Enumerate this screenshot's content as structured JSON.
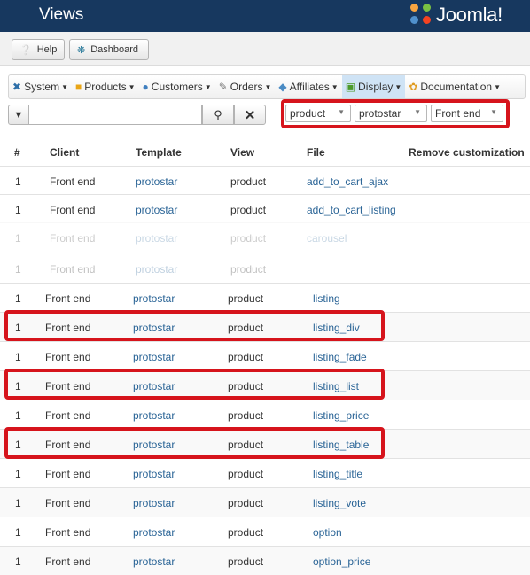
{
  "header": {
    "title": "Views",
    "logo_text": "Joomla!"
  },
  "toolbar": {
    "help_label": "Help",
    "dashboard_label": "Dashboard"
  },
  "menu": {
    "items": [
      {
        "label": "System",
        "icon": "wrench-icon"
      },
      {
        "label": "Products",
        "icon": "box-icon"
      },
      {
        "label": "Customers",
        "icon": "people-icon"
      },
      {
        "label": "Orders",
        "icon": "pencil-icon"
      },
      {
        "label": "Affiliates",
        "icon": "affiliates-icon"
      },
      {
        "label": "Display",
        "icon": "display-icon",
        "active": true
      },
      {
        "label": "Documentation",
        "icon": "gear-icon"
      }
    ]
  },
  "search": {
    "value": "",
    "placeholder": ""
  },
  "filters": {
    "view": "product",
    "template": "protostar",
    "client": "Front end"
  },
  "table": {
    "headers": [
      "#",
      "Client",
      "Template",
      "View",
      "File",
      "Remove customization"
    ],
    "rows": [
      {
        "num": "1",
        "client": "Front end",
        "template": "protostar",
        "view": "product",
        "file": "add_to_cart_ajax"
      },
      {
        "num": "1",
        "client": "Front end",
        "template": "protostar",
        "view": "product",
        "file": "add_to_cart_listing"
      },
      {
        "num": "1",
        "client": "Front end",
        "template": "protostar",
        "view": "product",
        "file": "carousel",
        "faded": true
      },
      {
        "num": "1",
        "client": "Front end",
        "template": "protostar",
        "view": "product",
        "file": "",
        "faded": true
      },
      {
        "num": "1",
        "client": "Front end",
        "template": "protostar",
        "view": "product",
        "file": "listing"
      },
      {
        "num": "1",
        "client": "Front end",
        "template": "protostar",
        "view": "product",
        "file": "listing_div",
        "highlighted": true
      },
      {
        "num": "1",
        "client": "Front end",
        "template": "protostar",
        "view": "product",
        "file": "listing_fade"
      },
      {
        "num": "1",
        "client": "Front end",
        "template": "protostar",
        "view": "product",
        "file": "listing_list",
        "highlighted": true
      },
      {
        "num": "1",
        "client": "Front end",
        "template": "protostar",
        "view": "product",
        "file": "listing_price"
      },
      {
        "num": "1",
        "client": "Front end",
        "template": "protostar",
        "view": "product",
        "file": "listing_table",
        "highlighted": true
      },
      {
        "num": "1",
        "client": "Front end",
        "template": "protostar",
        "view": "product",
        "file": "listing_title"
      },
      {
        "num": "1",
        "client": "Front end",
        "template": "protostar",
        "view": "product",
        "file": "listing_vote"
      },
      {
        "num": "1",
        "client": "Front end",
        "template": "protostar",
        "view": "product",
        "file": "option"
      },
      {
        "num": "1",
        "client": "Front end",
        "template": "protostar",
        "view": "product",
        "file": "option_price"
      }
    ]
  },
  "colors": {
    "header_bg": "#17385f",
    "link": "#2a6496",
    "highlight": "#d6141c",
    "active_menu": "#cfe3f5"
  }
}
